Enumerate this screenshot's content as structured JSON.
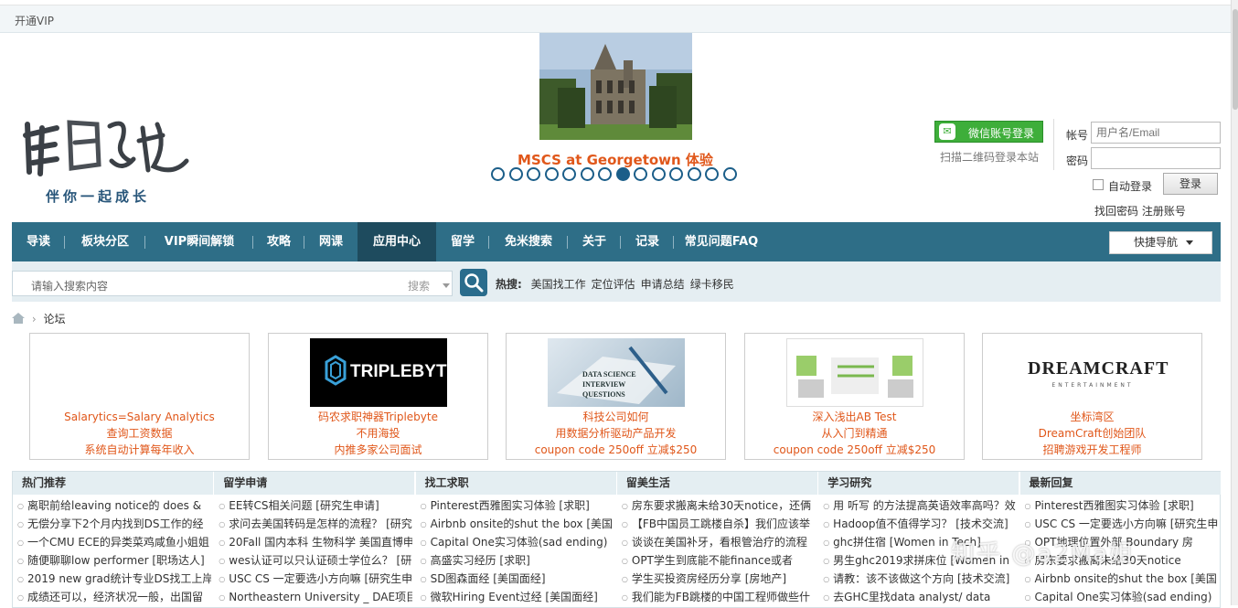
{
  "topbar": {
    "vip": "开通VIP"
  },
  "logo": {
    "mark": "留学地",
    "slogan": "伴你一起成长"
  },
  "banner": {
    "caption": "MSCS at Georgetown 体验",
    "dot_count": 14,
    "active_dot": 8
  },
  "login": {
    "wechat_btn": "微信账号登录",
    "wechat_icon": "wechat-icon",
    "scan_hint": "扫描二维码登录本站",
    "account_label": "帐号",
    "account_placeholder": "用户名/Email",
    "password_label": "密码",
    "auto_login": "自动登录",
    "login_btn": "登录",
    "find_pwd": "找回密码",
    "register": "注册账号"
  },
  "nav": {
    "items": [
      "导读",
      "板块分区",
      "VIP瞬间解锁",
      "攻略",
      "网课",
      "应用中心",
      "留学",
      "免米搜索",
      "关于",
      "记录",
      "常见问题FAQ"
    ],
    "active_index": 5,
    "quick_nav": "快捷导航"
  },
  "search": {
    "placeholder": "请输入搜索内容",
    "type_select": "搜索",
    "hot_label": "热搜:",
    "hot_items": [
      "美国找工作",
      "定位评估",
      "申请总结",
      "绿卡移民"
    ]
  },
  "breadcrumb": {
    "current": "论坛"
  },
  "ads": [
    {
      "lines": [
        "Salarytics=Salary Analytics",
        "查询工资数据",
        "系统自动计算每年收入"
      ]
    },
    {
      "lines": [
        "码农求职神器Triplebyte",
        "不用海投",
        "内推多家公司面试"
      ],
      "image_text": "TRIPLEBYTE"
    },
    {
      "lines": [
        "科技公司如何",
        "用数据分析驱动产品开发",
        "coupon code 250off 立减$250"
      ],
      "image_text": "DATA SCIENCE INTERVIEW QUESTIONS"
    },
    {
      "lines": [
        "深入浅出AB Test",
        "从入门到精通",
        "coupon code 250off 立减$250"
      ]
    },
    {
      "lines": [
        "坐标湾区",
        "DreamCraft创始团队",
        "招聘游戏开发工程师"
      ],
      "image_text": "DREAMCRAFT",
      "image_subtext": "ENTERTAINMENT"
    }
  ],
  "columns": [
    {
      "title": "热门推荐",
      "items": [
        "离职前给leaving notice的 does &",
        "无偿分享下2个月内找到DS工作的经",
        "一个CMU ECE的异类菜鸡咸鱼小姐姐",
        "随便聊聊low performer [职场达人]",
        "2019 new grad统计专业DS找工上岸",
        "成绩还可以，经济状况一般，出国留"
      ]
    },
    {
      "title": "留学申请",
      "items": [
        "EE转CS相关问题 [研究生申请]",
        "求问去美国转码是怎样的流程？ [研究",
        "20Fall 国内本科 生物科学 美国直博申",
        "wes认证可以只认证硕士学位么？ [研",
        "USC CS 一定要选小方向嘛 [研究生申",
        "Northeastern University _ DAE项目"
      ]
    },
    {
      "title": "找工求职",
      "items": [
        "Pinterest西雅图实习体验 [求职]",
        "Airbnb onsite的shut the box [美国",
        "Capital One实习体验(sad ending)",
        "高盛实习经历 [求职]",
        "SD图森面经 [美国面经]",
        "微软Hiring Event过经 [美国面经]"
      ]
    },
    {
      "title": "留美生活",
      "items": [
        "房东要求搬离未给30天notice，还俩",
        "【FB中国员工跳楼自杀】我们应该举",
        "谈谈在美国补牙，看根管治疗的流程",
        "OPT学生到底能不能finance或者",
        "学生买投资房经历分享 [房地产]",
        "我们能为FB跳楼的中国工程师做些什"
      ]
    },
    {
      "title": "学习研究",
      "items": [
        "用 听写 的方法提高英语效率高吗？效",
        "Hadoop值不值得学习？ [技术交流]",
        "ghc拼住宿 [Women in Tech]",
        "男生ghc2019求拼床位 [Women in",
        "请教：该不该做这个方向 [技术交流]",
        "去GHC里找data analyst/ data"
      ]
    },
    {
      "title": "最新回复",
      "items": [
        "Pinterest西雅图实习体验 [求职]",
        "USC CS 一定要选小方向嘛 [研究生申",
        "OPT地理位置外部 Boundary 房",
        "房东要求搬离未给30天notice",
        "Airbnb onsite的shut the box [美国",
        "Capital One实习体验(sad ending)"
      ]
    }
  ],
  "watermark": "知乎 @a2Ma姐"
}
